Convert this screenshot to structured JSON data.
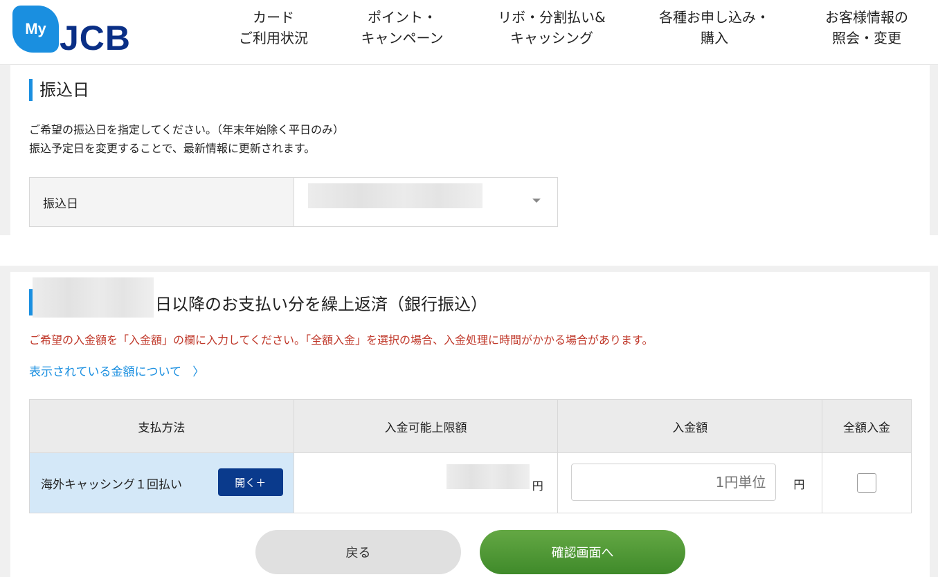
{
  "header": {
    "logo_my": "My",
    "logo_jcb": "JCB",
    "nav": [
      {
        "line1": "カード",
        "line2": "ご利用状況"
      },
      {
        "line1": "ポイント・",
        "line2": "キャンペーン"
      },
      {
        "line1": "リボ・分割払い&",
        "line2": "キャッシング"
      },
      {
        "line1": "各種お申し込み・",
        "line2": "購入"
      },
      {
        "line1": "お客様情報の",
        "line2": "照会・変更"
      }
    ]
  },
  "transfer_date": {
    "title": "振込日",
    "desc1": "ご希望の振込日を指定してください。（年末年始除く平日のみ）",
    "desc2": "振込予定日を変更することで、最新情報に更新されます。",
    "label": "振込日"
  },
  "repayment": {
    "title_suffix": "日以降のお支払い分を繰上返済（銀行振込）",
    "warning": "ご希望の入金額を「入金額」の欄に入力してください。「全額入金」を選択の場合、入金処理に時間がかかる場合があります。",
    "link": "表示されている金額について",
    "headers": [
      "支払方法",
      "入金可能上限額",
      "入金額",
      "全額入金"
    ],
    "row": {
      "method": "海外キャッシング１回払い",
      "open_label": "開く＋",
      "yen": "円",
      "amount_placeholder": "1円単位",
      "amount_yen": "円"
    },
    "back_label": "戻る",
    "confirm_label": "確認画面へ"
  }
}
